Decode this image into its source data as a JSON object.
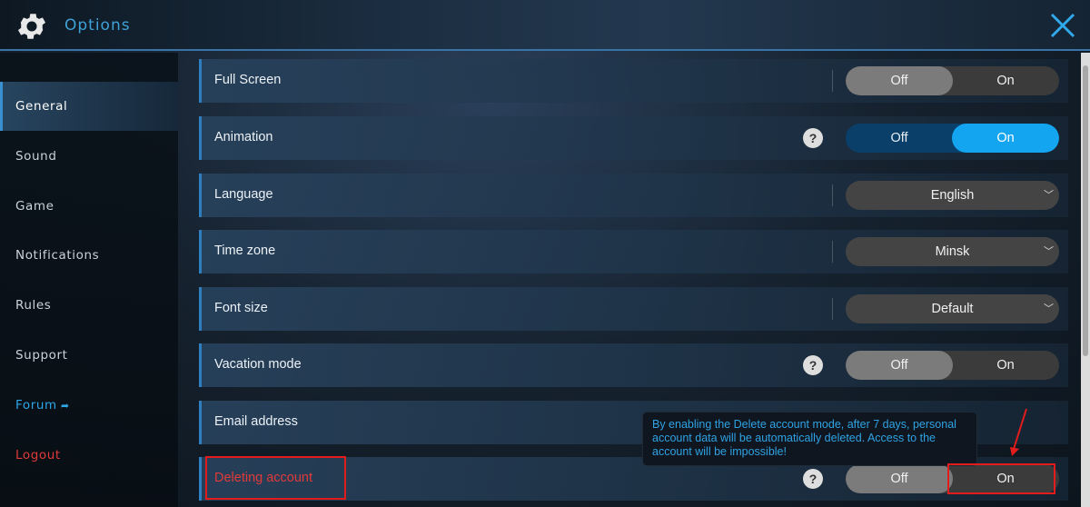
{
  "header": {
    "title": "Options",
    "icon": "gear-icon",
    "close_icon": "close-icon",
    "accent": "#3fa2d8"
  },
  "sidebar": {
    "items": [
      {
        "label": "General",
        "active": true
      },
      {
        "label": "Sound"
      },
      {
        "label": "Game"
      },
      {
        "label": "Notifications"
      },
      {
        "label": "Rules"
      },
      {
        "label": "Support"
      },
      {
        "label": "Forum",
        "icon": "external-link-icon",
        "color": "#2ea6e8"
      },
      {
        "label": "Logout",
        "color": "#e03b3b"
      }
    ]
  },
  "settings": [
    {
      "label": "Full Screen",
      "type": "toggle",
      "off_label": "Off",
      "on_label": "On",
      "value": "Off"
    },
    {
      "label": "Animation",
      "type": "toggle",
      "help": "?",
      "off_label": "Off",
      "on_label": "On",
      "value": "On"
    },
    {
      "label": "Language",
      "type": "select",
      "value": "English"
    },
    {
      "label": "Time zone",
      "type": "select",
      "value": "Minsk"
    },
    {
      "label": "Font size",
      "type": "select",
      "value": "Default"
    },
    {
      "label": "Vacation mode",
      "type": "toggle",
      "help": "?",
      "off_label": "Off",
      "on_label": "On",
      "value": "Off"
    },
    {
      "label": "Email address",
      "type": "text"
    },
    {
      "label": "Deleting account",
      "type": "toggle",
      "help": "?",
      "off_label": "Off",
      "on_label": "On",
      "value": "Off"
    }
  ],
  "tooltip": {
    "text": "By enabling the Delete account mode, after 7 days, personal account data will be automatically deleted. Access to the account will be impossible!"
  },
  "colors": {
    "toggle_on": "#14a5f0",
    "toggle_off": "#7b7b7b",
    "danger": "#e23a3a",
    "annotation": "#e21c1c"
  }
}
